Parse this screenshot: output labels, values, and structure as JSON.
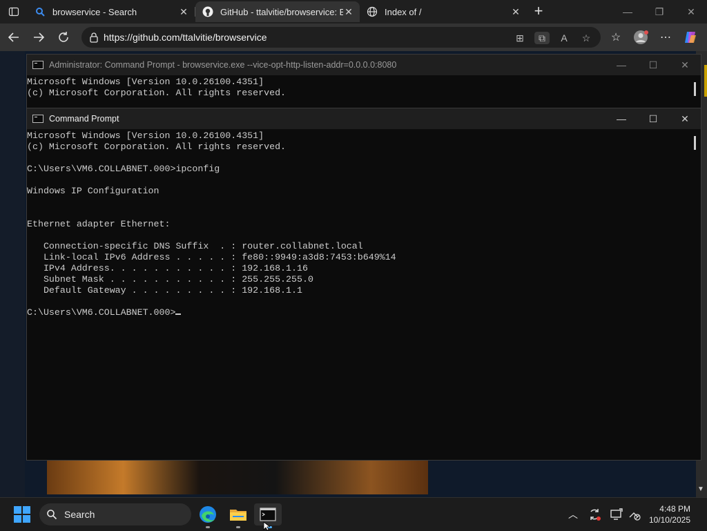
{
  "browser": {
    "tabs": [
      {
        "title": "browservice - Search",
        "icon": "search-icon"
      },
      {
        "title": "GitHub - ttalvitie/browservice: Br",
        "icon": "github-icon",
        "active": true
      },
      {
        "title": "Index of /",
        "icon": "globe-icon"
      }
    ],
    "url": "https://github.com/ttalvitie/browservice"
  },
  "console_back": {
    "title": "Administrator: Command Prompt - browservice.exe  --vice-opt-http-listen-addr=0.0.0.0:8080",
    "lines": [
      "Microsoft Windows [Version 10.0.26100.4351]",
      "(c) Microsoft Corporation. All rights reserved."
    ]
  },
  "console_front": {
    "title": "Command Prompt",
    "lines": [
      "Microsoft Windows [Version 10.0.26100.4351]",
      "(c) Microsoft Corporation. All rights reserved.",
      "",
      "C:\\Users\\VM6.COLLABNET.000>ipconfig",
      "",
      "Windows IP Configuration",
      "",
      "",
      "Ethernet adapter Ethernet:",
      "",
      "   Connection-specific DNS Suffix  . : router.collabnet.local",
      "   Link-local IPv6 Address . . . . . : fe80::9949:a3d8:7453:b649%14",
      "   IPv4 Address. . . . . . . . . . . : 192.168.1.16",
      "   Subnet Mask . . . . . . . . . . . : 255.255.255.0",
      "   Default Gateway . . . . . . . . . : 192.168.1.1",
      ""
    ],
    "prompt": "C:\\Users\\VM6.COLLABNET.000>"
  },
  "taskbar": {
    "search_label": "Search",
    "time": "4:48 PM",
    "date": "10/10/2025"
  },
  "colors": {
    "accent": "#3fa6ff",
    "console_bg": "#0c0c0c",
    "console_text": "#cccccc"
  }
}
